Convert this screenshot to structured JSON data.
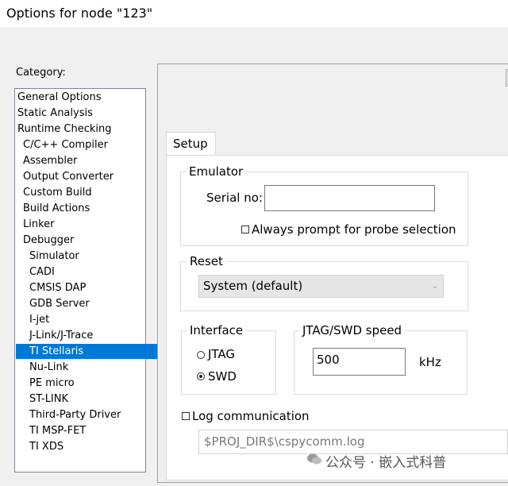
{
  "window": {
    "title": "Options for node \"123\""
  },
  "category": {
    "label": "Category:",
    "items": [
      "General Options",
      "Static Analysis",
      "Runtime Checking",
      "C/C++ Compiler",
      "Assembler",
      "Output Converter",
      "Custom Build",
      "Build Actions",
      "Linker",
      "Debugger",
      "Simulator",
      "CADI",
      "CMSIS DAP",
      "GDB Server",
      "I-jet",
      "J-Link/J-Trace",
      "TI Stellaris",
      "Nu-Link",
      "PE micro",
      "ST-LINK",
      "Third-Party Driver",
      "TI MSP-FET",
      "TI XDS"
    ],
    "selected": "TI Stellaris"
  },
  "tabs": {
    "setup": "Setup"
  },
  "emulator": {
    "label": "Emulator",
    "serial_label": "Serial no:",
    "serial_value": "",
    "prompt_label": "Always prompt for probe selection"
  },
  "reset": {
    "label": "Reset",
    "value": "System (default)"
  },
  "interface": {
    "label": "Interface",
    "jtag": "JTAG",
    "swd": "SWD",
    "selected": "SWD"
  },
  "speed": {
    "label": "JTAG/SWD speed",
    "value": "500",
    "unit": "kHz"
  },
  "log": {
    "label": "Log communication",
    "path": "$PROJ_DIR$\\cspycomm.log"
  },
  "watermark": "公众号 · 嵌入式科普"
}
